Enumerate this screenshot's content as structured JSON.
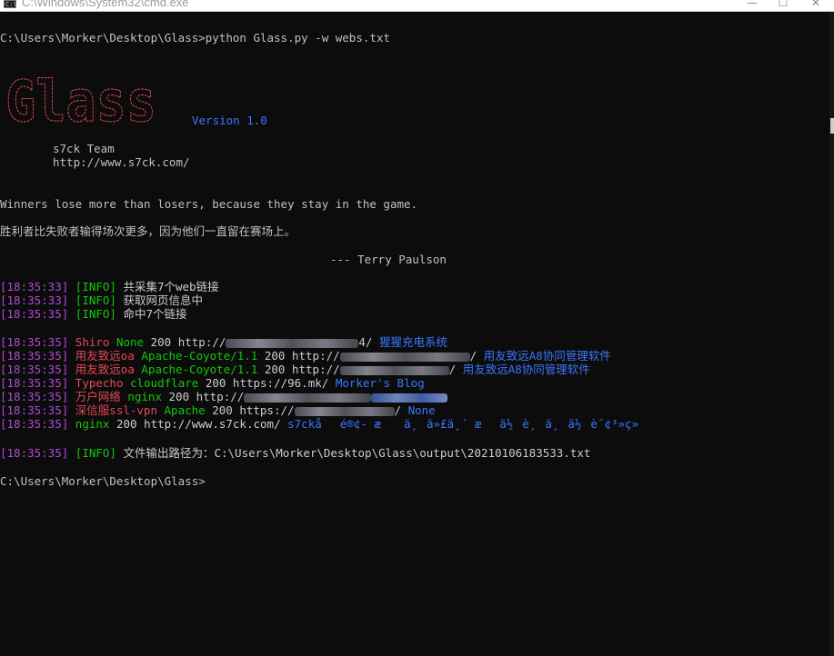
{
  "window": {
    "title": "C:\\Windows\\System32\\cmd.exe",
    "minimize_glyph": "—",
    "maximize_glyph": "☐",
    "close_glyph": "✕"
  },
  "colors": {
    "background": "#0c0c0c",
    "timestamp": "#b04ad6",
    "info": "#16c60c",
    "server": "#e74856",
    "link_title": "#3b78ff",
    "logo": "#e74856"
  },
  "terminal": {
    "command_line": "C:\\Users\\Morker\\Desktop\\Glass>python Glass.py -w webs.txt",
    "logo_text": "Glass",
    "version": "Version 1.0",
    "team": "s7ck Team",
    "url": "http://www.s7ck.com/",
    "quote_en": "Winners lose more than losers, because they stay in the game.",
    "quote_cn": "胜利者比失败者输得场次更多，因为他们一直留在赛场上。",
    "quote_author": "--- Terry Paulson",
    "info_lines": [
      {
        "time": "[18:35:33]",
        "tag": "[INFO]",
        "text": "共采集7个web链接"
      },
      {
        "time": "[18:35:33]",
        "tag": "[INFO]",
        "text": "获取网页信息中"
      },
      {
        "time": "[18:35:35]",
        "tag": "[INFO]",
        "text": "命中7个链接"
      }
    ],
    "results": [
      {
        "time": "[18:35:35]",
        "cms": "Shiro",
        "server": "None",
        "code": "200",
        "url_prefix": "http://",
        "url_suffix": "4/",
        "title": "猩猩充电系统"
      },
      {
        "time": "[18:35:35]",
        "cms": "用友致远oa",
        "server": "Apache-Coyote/1.1",
        "code": "200",
        "url_prefix": "http://",
        "url_suffix": "/",
        "title": "用友致远A8协同管理软件"
      },
      {
        "time": "[18:35:35]",
        "cms": "用友致远oa",
        "server": "Apache-Coyote/1.1",
        "code": "200",
        "url_prefix": "http://",
        "url_suffix": "/",
        "title": "用友致远A8协同管理软件"
      },
      {
        "time": "[18:35:35]",
        "cms": "Typecho",
        "server": "cloudflare",
        "code": "200",
        "url_prefix": "https://96.mk/",
        "url_suffix": "",
        "title": "Morker's Blog"
      },
      {
        "time": "[18:35:35]",
        "cms": "万户网络",
        "server": "nginx",
        "code": "200",
        "url_prefix": "http://",
        "url_suffix": "",
        "title": ""
      },
      {
        "time": "[18:35:35]",
        "cms": "深信服ssl-vpn",
        "server": "Apache",
        "code": "200",
        "url_prefix": "https://",
        "url_suffix": "/",
        "title": "None"
      },
      {
        "time": "[18:35:35]",
        "cms": "",
        "server": "nginx",
        "code": "200",
        "url_prefix": "http://www.s7ck.com/",
        "url_suffix": "",
        "title": "s7ckåé®¢- æ  ä¸ä»£ä¸´ æä½è¸ä¸ä½è¯¢³»ç»"
      }
    ],
    "output_line": {
      "time": "[18:35:35]",
      "tag": "[INFO]",
      "text": "文件输出路径为：C:\\Users\\Morker\\Desktop\\Glass\\output\\20210106183533.txt"
    },
    "prompt": "C:\\Users\\Morker\\Desktop\\Glass>"
  }
}
